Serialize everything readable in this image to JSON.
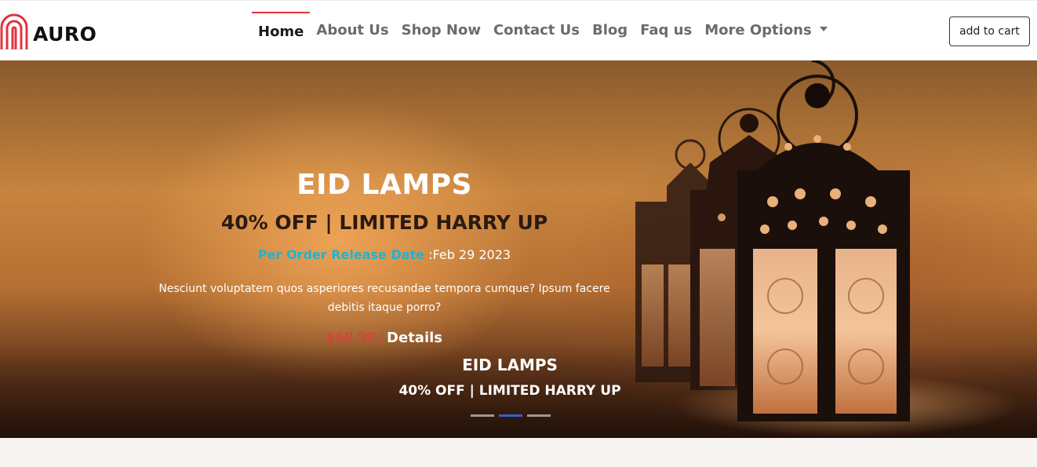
{
  "brand": {
    "name": "AURO",
    "accent_color": "#e1333f"
  },
  "nav": {
    "items": [
      {
        "label": "Home",
        "active": true
      },
      {
        "label": "About Us"
      },
      {
        "label": "Shop Now"
      },
      {
        "label": "Contact Us"
      },
      {
        "label": "Blog"
      },
      {
        "label": "Faq us"
      },
      {
        "label": "More Options",
        "dropdown": true
      }
    ],
    "cart_label": "add to cart"
  },
  "hero": {
    "title": "EID LAMPS",
    "subtitle": "40% OFF | LIMITED HARRY UP",
    "date_label": "Per Order Release Date",
    "date_value": ":Feb 29 2023",
    "description": "Nesciunt voluptatem quos asperiores recusandae tempora cumque? Ipsum facere debitis itaque porro?",
    "price": "$68.98",
    "separator": "|",
    "details_label": "Details",
    "secondary_title": "EID LAMPS",
    "secondary_subtitle": "40% OFF | LIMITED HARRY UP",
    "slides": 3,
    "active_slide": 2
  },
  "colors": {
    "link_cyan": "#19b5d8",
    "price_red": "#e03a44",
    "indicator_active": "#3a5bd6"
  }
}
